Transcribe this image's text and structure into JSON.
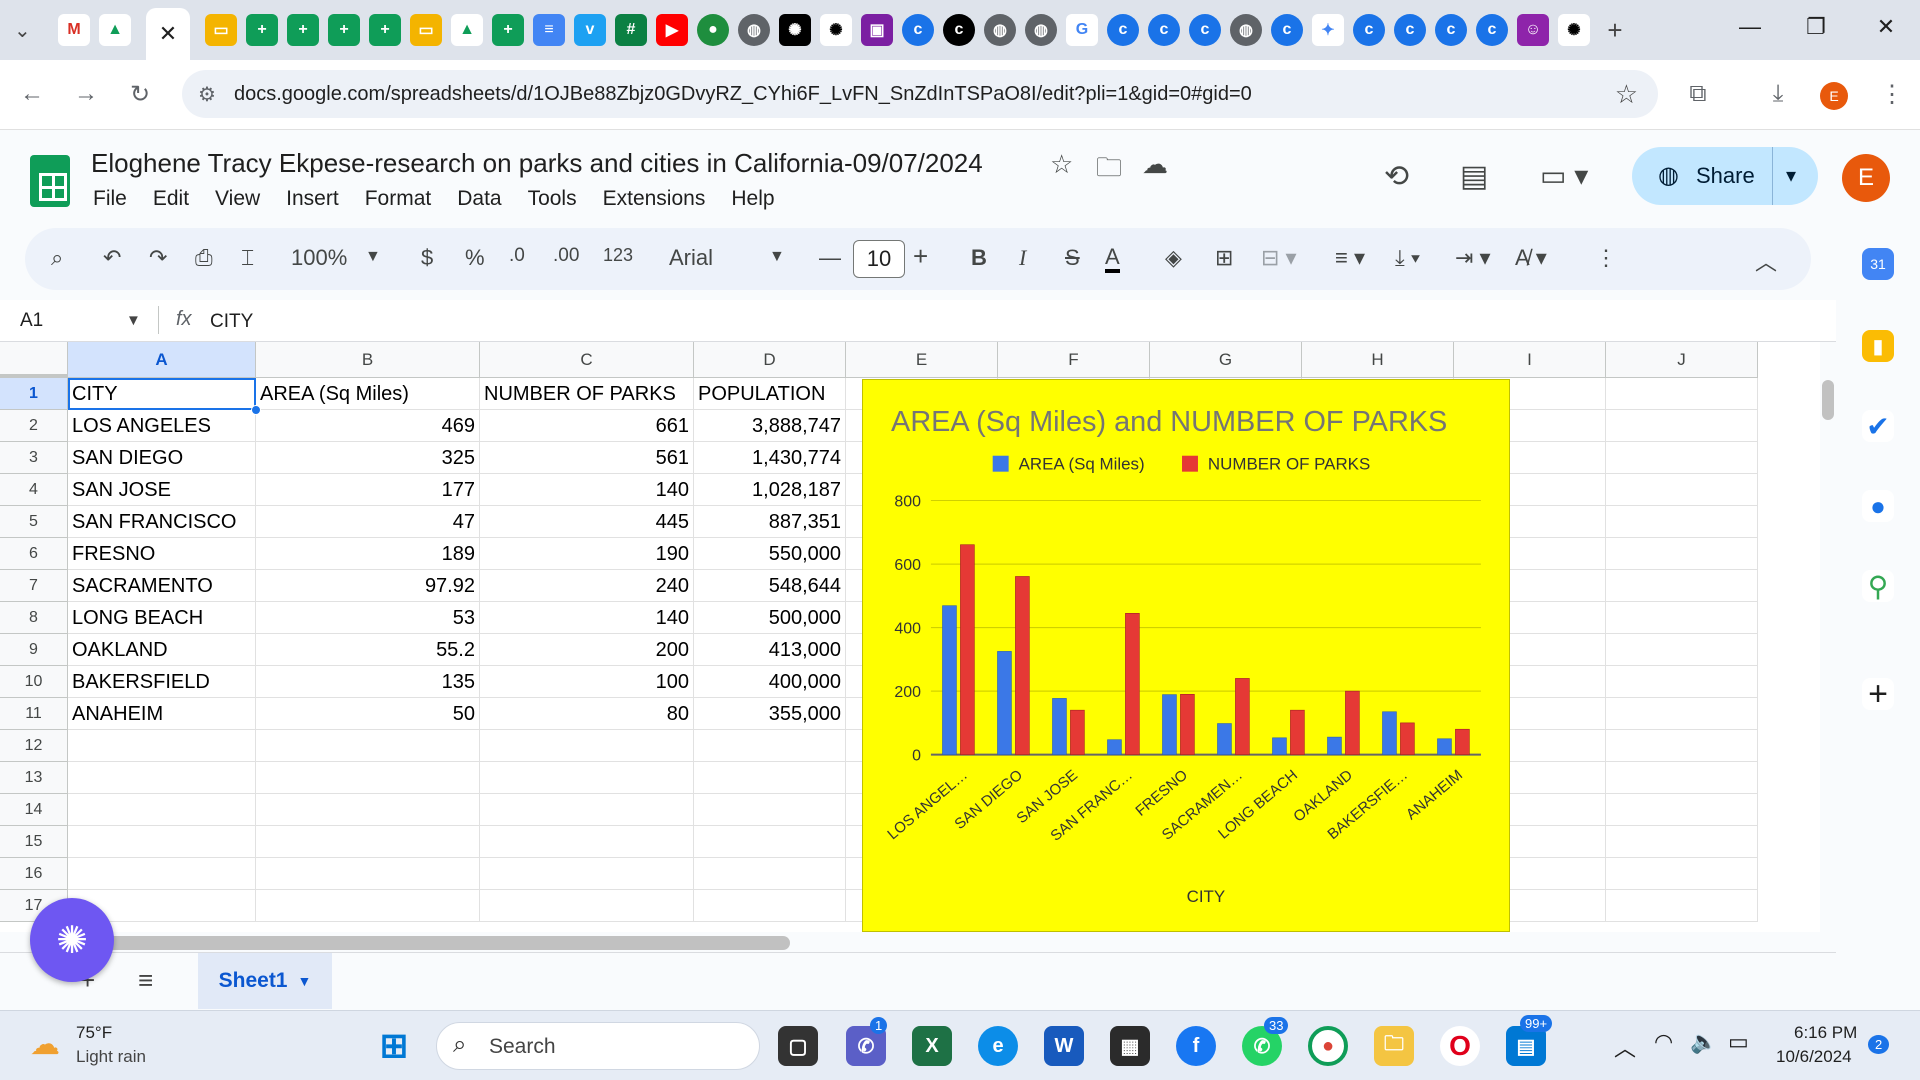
{
  "browser": {
    "url": "docs.google.com/spreadsheets/d/1OJBe88Zbjz0GDvyRZ_CYhi6F_LvFN_SnZdInTSPaO8I/edit?pli=1&gid=0#gid=0",
    "profile_initial": "E",
    "close_tab": "✕",
    "new_tab": "+"
  },
  "doc": {
    "title": "Eloghene Tracy Ekpese-research on parks and cities in California-09/07/2024",
    "menu": [
      "File",
      "Edit",
      "View",
      "Insert",
      "Format",
      "Data",
      "Tools",
      "Extensions",
      "Help"
    ],
    "share_label": "Share",
    "user_initial": "E"
  },
  "toolbar": {
    "zoom": "100%",
    "currency": "$",
    "percent": "%",
    "dec_decrease": ".0",
    "dec_increase": ".00",
    "number_format": "123",
    "font": "Arial",
    "font_size": "10",
    "bold": "B",
    "italic": "I",
    "strike": "S",
    "text_color": "A"
  },
  "formula_bar": {
    "cell_ref": "A1",
    "fx": "fx",
    "value": "CITY"
  },
  "grid": {
    "columns": [
      "A",
      "B",
      "C",
      "D",
      "E",
      "F",
      "G",
      "H",
      "I",
      "J"
    ],
    "rows": [
      "1",
      "2",
      "3",
      "4",
      "5",
      "6",
      "7",
      "8",
      "9",
      "10",
      "11",
      "12",
      "13",
      "14",
      "15",
      "16",
      "17"
    ],
    "headers": [
      "CITY",
      "AREA (Sq Miles)",
      "NUMBER OF PARKS",
      "POPULATION"
    ],
    "data": [
      [
        "LOS ANGELES",
        "469",
        "661",
        "3,888,747"
      ],
      [
        "SAN DIEGO",
        "325",
        "561",
        "1,430,774"
      ],
      [
        "SAN JOSE",
        "177",
        "140",
        "1,028,187"
      ],
      [
        "SAN FRANCISCO",
        "47",
        "445",
        "887,351"
      ],
      [
        "FRESNO",
        "189",
        "190",
        "550,000"
      ],
      [
        "SACRAMENTO",
        "97.92",
        "240",
        "548,644"
      ],
      [
        "LONG BEACH",
        "53",
        "140",
        "500,000"
      ],
      [
        "OAKLAND",
        "55.2",
        "200",
        "413,000"
      ],
      [
        "BAKERSFIELD",
        "135",
        "100",
        "400,000"
      ],
      [
        "ANAHEIM",
        "50",
        "80",
        "355,000"
      ]
    ]
  },
  "chart_data": {
    "type": "bar",
    "title": "AREA (Sq Miles) and NUMBER OF PARKS",
    "xlabel": "CITY",
    "ylabel": "",
    "categories": [
      "LOS ANGEL…",
      "SAN DIEGO",
      "SAN JOSE",
      "SAN FRANC…",
      "FRESNO",
      "SACRAMEN…",
      "LONG BEACH",
      "OAKLAND",
      "BAKERSFIE…",
      "ANAHEIM"
    ],
    "series": [
      {
        "name": "AREA (Sq Miles)",
        "color": "#3b78e7",
        "values": [
          469,
          325,
          177,
          47,
          189,
          97.92,
          53,
          55.2,
          135,
          50
        ]
      },
      {
        "name": "NUMBER OF PARKS",
        "color": "#e53935",
        "values": [
          661,
          561,
          140,
          445,
          190,
          240,
          140,
          200,
          100,
          80
        ]
      }
    ],
    "ylim": [
      0,
      800
    ],
    "yticks": [
      "0",
      "200",
      "400",
      "600",
      "800"
    ],
    "background": "#ffff00",
    "legend": "top",
    "grid": true
  },
  "sheets": {
    "active": "Sheet1",
    "add": "+",
    "list": "≡"
  },
  "taskbar": {
    "weather_temp": "75°F",
    "weather_desc": "Light rain",
    "search_label": "Search",
    "time": "6:16 PM",
    "date": "10/6/2024",
    "teams_badge": "1",
    "whatsapp_badge": "33",
    "store_badge": "99+",
    "notif_badge": "2"
  }
}
